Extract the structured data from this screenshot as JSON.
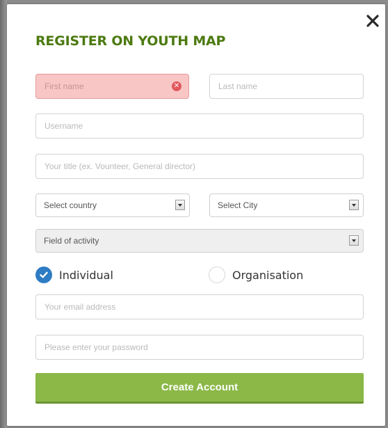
{
  "form": {
    "title": "REGISTER ON YOUTH MAP",
    "first_name_placeholder": "First name",
    "last_name_placeholder": "Last name",
    "username_placeholder": "Username",
    "job_title_placeholder": "Your title (ex. Vounteer, General director)",
    "country_select": "Select country",
    "city_select": "Select City",
    "activity_select": "Field of activity",
    "account_types": [
      {
        "label": "Individual",
        "checked": true
      },
      {
        "label": "Organisation",
        "checked": false
      }
    ],
    "email_placeholder": "Your email address",
    "password_placeholder": "Please enter your password",
    "submit_label": "Create Account"
  },
  "icons": {
    "close": "close-icon",
    "error": "error-icon",
    "check": "checkmark-icon",
    "dropdown": "dropdown-arrow-icon"
  },
  "colors": {
    "title": "#4c7a10",
    "submit_bg": "#8bb847",
    "error_bg": "#f9c6c6",
    "radio_checked": "#2e7cc4"
  }
}
